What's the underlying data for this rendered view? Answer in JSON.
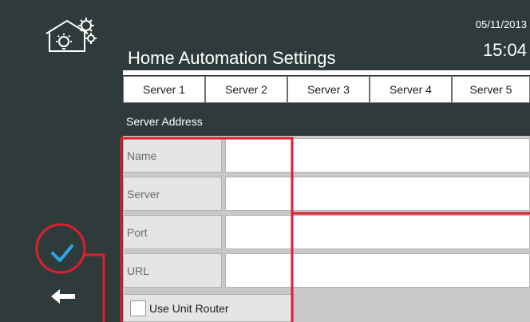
{
  "header": {
    "title": "Home Automation Settings",
    "date": "05/11/2013",
    "time": "15:04",
    "logo_icon": "house-gear-icon"
  },
  "tabs": [
    {
      "label": "Server 1",
      "active": true
    },
    {
      "label": "Server 2",
      "active": false
    },
    {
      "label": "Server 3",
      "active": false
    },
    {
      "label": "Server 4",
      "active": false
    },
    {
      "label": "Server 5",
      "active": false
    }
  ],
  "section": {
    "title": "Server Address"
  },
  "fields": [
    {
      "label": "Name",
      "value": ""
    },
    {
      "label": "Server",
      "value": ""
    },
    {
      "label": "Port",
      "value": ""
    },
    {
      "label": "URL",
      "value": ""
    }
  ],
  "router": {
    "label": "Use Unit Router",
    "checked": false
  },
  "sidebar": {
    "confirm_icon": "checkmark-icon",
    "back_icon": "back-arrow-icon"
  },
  "colors": {
    "panel": "#2f3b3b",
    "accent": "#29a8e0",
    "annotation": "#e01e2d"
  }
}
